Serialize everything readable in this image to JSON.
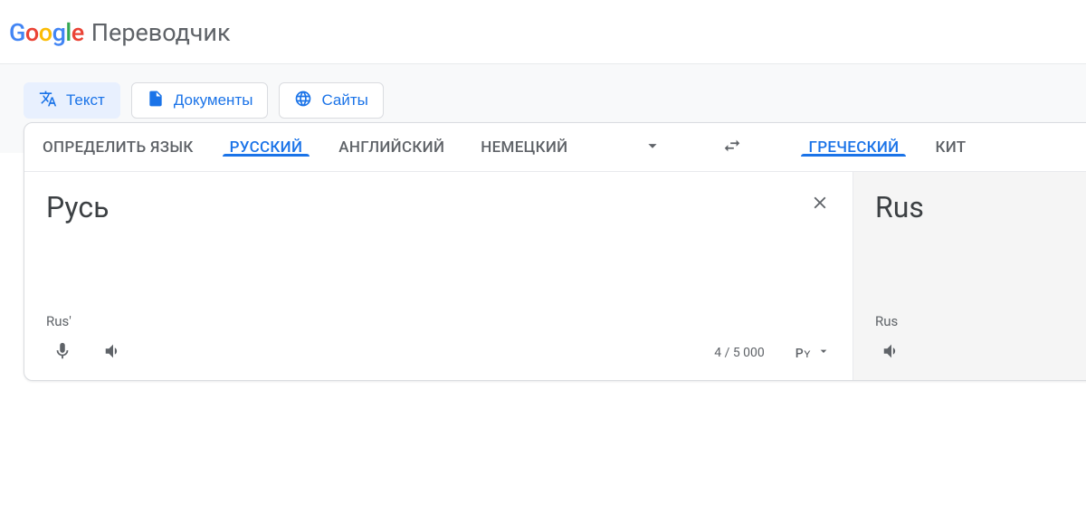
{
  "header": {
    "logo_letters": [
      "G",
      "o",
      "o",
      "g",
      "l",
      "e"
    ],
    "app_title": "Переводчик"
  },
  "modes": {
    "text": "Текст",
    "documents": "Документы",
    "sites": "Сайты"
  },
  "source_lang_tabs": {
    "detect": "ОПРЕДЕЛИТЬ ЯЗЫК",
    "russian": "РУССКИЙ",
    "english": "АНГЛИЙСКИЙ",
    "german": "НЕМЕЦКИЙ"
  },
  "target_lang_tabs": {
    "greek": "ГРЕЧЕСКИЙ",
    "chinese": "КИТ"
  },
  "src": {
    "text": "Русь",
    "translit": "Rus'",
    "counter": "4 / 5 000",
    "ime_label": "Рʏ"
  },
  "tgt": {
    "text": "Rus",
    "translit": "Rus"
  }
}
